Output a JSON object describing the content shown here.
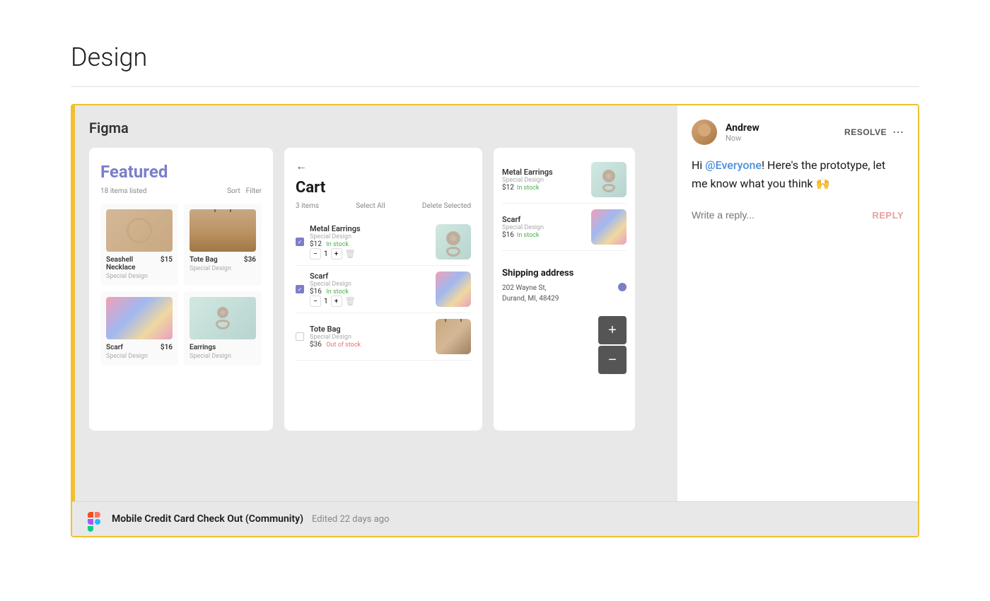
{
  "page": {
    "title": "Design"
  },
  "figma_panel": {
    "logo_text": "Figma",
    "screen1": {
      "title": "Featured",
      "meta_count": "18 items listed",
      "sort_label": "Sort",
      "filter_label": "Filter",
      "items": [
        {
          "name": "Seashell Necklace",
          "price": "$15",
          "sub": "Special Design",
          "type": "necklace"
        },
        {
          "name": "Tote Bag",
          "price": "$36",
          "sub": "Special Design",
          "type": "tote"
        },
        {
          "name": "Scarf",
          "price": "$16",
          "sub": "Special Design",
          "type": "scarf"
        },
        {
          "name": "Earrings",
          "price": "",
          "sub": "Special Design",
          "type": "earrings"
        }
      ]
    },
    "screen2": {
      "title": "Cart",
      "item_count": "3 items",
      "select_all": "Select All",
      "delete_selected": "Delete Selected",
      "items": [
        {
          "name": "Metal Earrings",
          "sub": "Special Design",
          "price": "$12",
          "stock": "In stock",
          "qty": 1,
          "checked": true,
          "type": "earrings"
        },
        {
          "name": "Scarf",
          "sub": "Special Design",
          "price": "$16",
          "stock": "In stock",
          "qty": 1,
          "checked": true,
          "type": "scarf"
        },
        {
          "name": "Tote Bag",
          "sub": "Special Design",
          "price": "$36",
          "stock": "Out of stock",
          "qty": 1,
          "checked": false,
          "type": "tote"
        }
      ]
    },
    "screen3": {
      "items": [
        {
          "name": "Metal Earrings",
          "sub": "Special Design",
          "price": "$12",
          "stock": "In stock",
          "type": "earrings"
        },
        {
          "name": "Scarf",
          "sub": "Special Design",
          "price": "$16",
          "stock": "In stock",
          "type": "scarf"
        }
      ],
      "shipping": {
        "title": "Shipping address",
        "address": "202 Wayne St,",
        "city": "Durand, MI, 48429"
      }
    }
  },
  "comment": {
    "author": "Andrew",
    "time": "Now",
    "resolve_label": "RESOLVE",
    "more_icon": "⋯",
    "body_prefix": "Hi ",
    "mention": "@Everyone",
    "body_suffix": "! Here's the prototype, let me know what you think 🙌",
    "reply_placeholder": "Write a reply...",
    "reply_button": "REPLY"
  },
  "footer": {
    "title": "Mobile Credit Card Check Out (Community)",
    "meta": "Edited 22 days ago"
  },
  "zoom": {
    "plus": "+",
    "minus": "−"
  }
}
